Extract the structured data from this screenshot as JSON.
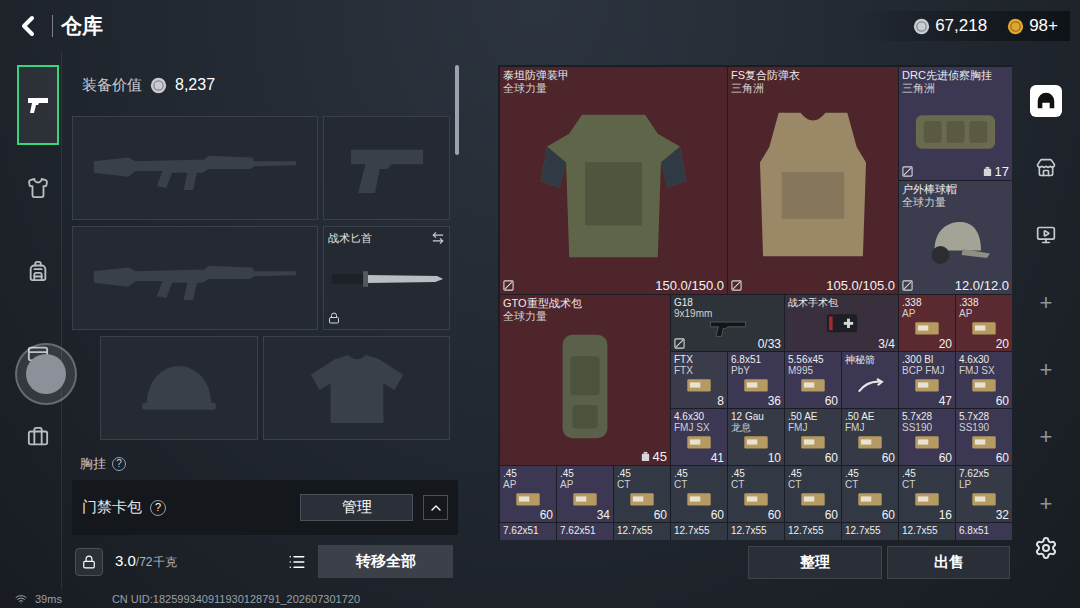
{
  "header": {
    "title": "仓库"
  },
  "currencies": [
    {
      "amount": "67,218",
      "color": "#c9ccd2"
    },
    {
      "amount": "98+",
      "color": "#e3a62b"
    }
  ],
  "side_tabs": [
    {
      "kind": "weapon",
      "selected": true
    },
    {
      "kind": "armor",
      "selected": false
    },
    {
      "kind": "backpack",
      "selected": false
    },
    {
      "kind": "card",
      "selected": false
    },
    {
      "kind": "case",
      "selected": false
    }
  ],
  "loadout": {
    "value_label": "装备价值",
    "value": "8,237",
    "slots": [
      {
        "kind": "rifle",
        "locked": false
      },
      {
        "kind": "pistol",
        "locked": false
      },
      {
        "kind": "rifle",
        "locked": false
      },
      {
        "kind": "knife",
        "label": "战术匕首",
        "locked": true
      },
      {
        "kind": "helmet",
        "locked": false
      },
      {
        "kind": "body-armor",
        "locked": false
      }
    ],
    "next_section": {
      "label": "胸挂",
      "help": "?"
    }
  },
  "keycard_bag": {
    "label": "门禁卡包",
    "help": "?",
    "button": "管理"
  },
  "weight": {
    "current": "3.0",
    "capacity": "/72千克"
  },
  "transfer_button": "转移全部",
  "storage": {
    "items": [
      {
        "name": "泰坦防弹装甲",
        "sub": "全球力量",
        "value": "150.0/150.0",
        "kind": "armor",
        "color": "#4e252b",
        "bound": true,
        "value_icon": false
      },
      {
        "name": "FS复合防弹衣",
        "sub": "三角洲",
        "value": "105.0/105.0",
        "kind": "vest",
        "color": "#4e252b",
        "bound": true,
        "value_icon": false
      },
      {
        "name": "DRC先进侦察胸挂",
        "sub": "三角洲",
        "value": "17",
        "kind": "rig",
        "color": "#3c3752",
        "bound": true,
        "value_icon": true
      },
      {
        "name": "户外棒球帽",
        "sub": "全球力量",
        "value": "12.0/12.0",
        "kind": "hat",
        "color": "#3b3d4f",
        "bound": true,
        "value_icon": false
      },
      {
        "name": "GTO重型战术包",
        "sub": "全球力量",
        "value": "45",
        "kind": "backpack",
        "color": "#4e252b",
        "bound": false,
        "value_icon": true
      },
      {
        "name": "G18",
        "sub": "9x19mm",
        "value": "0/33",
        "kind": "pistol",
        "color": "#2e3239",
        "bound": true,
        "value_icon": false
      },
      {
        "name": "战术手术包",
        "value": "3/4",
        "kind": "medkit",
        "color": "#3a2f3c",
        "bound": false,
        "value_icon": false
      },
      {
        "name": ".338",
        "sub": "AP",
        "value": "20",
        "kind": "ammo",
        "color": "#5b2930",
        "bound": false,
        "value_icon": false
      },
      {
        "name": ".338",
        "sub": "AP",
        "value": "20",
        "kind": "ammo",
        "color": "#5b2930",
        "bound": false,
        "value_icon": false
      },
      {
        "name": "FTX",
        "sub": "FTX",
        "value": "8",
        "kind": "ammo",
        "color": "#3a3b4b",
        "bound": false,
        "value_icon": false
      },
      {
        "name": "6.8x51",
        "sub": "PbY",
        "value": "36",
        "kind": "ammo",
        "color": "#3c3752",
        "bound": false,
        "value_icon": false
      },
      {
        "name": "5.56x45",
        "sub": "M995",
        "value": "60",
        "kind": "ammo",
        "color": "#3c3752",
        "bound": false,
        "value_icon": false
      },
      {
        "name": "神秘箭",
        "value": "",
        "kind": "arrow",
        "color": "#3c3752",
        "bound": false,
        "value_icon": false
      },
      {
        "name": ".300 Bl",
        "sub": "BCP FMJ",
        "value": "47",
        "kind": "ammo",
        "color": "#3c3752",
        "bound": false,
        "value_icon": false
      },
      {
        "name": "4.6x30",
        "sub": "FMJ SX",
        "value": "60",
        "kind": "ammo",
        "color": "#3c3752",
        "bound": false,
        "value_icon": false
      },
      {
        "name": "4.6x30",
        "sub": "FMJ SX",
        "value": "41",
        "kind": "ammo",
        "color": "#3c3752",
        "bound": false,
        "value_icon": false
      },
      {
        "name": "12 Gau",
        "sub": "龙息",
        "value": "10",
        "kind": "ammo",
        "color": "#353a46",
        "bound": false,
        "value_icon": false
      },
      {
        "name": ".50 AE",
        "sub": "FMJ",
        "value": "60",
        "kind": "ammo",
        "color": "#353a46",
        "bound": false,
        "value_icon": false
      },
      {
        "name": ".50 AE",
        "sub": "FMJ",
        "value": "60",
        "kind": "ammo",
        "color": "#353a46",
        "bound": false,
        "value_icon": false
      },
      {
        "name": "5.7x28",
        "sub": "SS190",
        "value": "60",
        "kind": "ammo",
        "color": "#3c3752",
        "bound": false,
        "value_icon": false
      },
      {
        "name": "5.7x28",
        "sub": "SS190",
        "value": "60",
        "kind": "ammo",
        "color": "#3c3752",
        "bound": false,
        "value_icon": false
      },
      {
        "name": ".45",
        "sub": "AP",
        "value": "60",
        "kind": "ammo",
        "color": "#3c3752",
        "bound": false,
        "value_icon": false
      },
      {
        "name": ".45",
        "sub": "AP",
        "value": "34",
        "kind": "ammo",
        "color": "#3c3752",
        "bound": false,
        "value_icon": false
      },
      {
        "name": ".45",
        "sub": "CT",
        "value": "60",
        "kind": "ammo",
        "color": "#323844",
        "bound": false,
        "value_icon": false
      },
      {
        "name": ".45",
        "sub": "CT",
        "value": "60",
        "kind": "ammo",
        "color": "#323844",
        "bound": false,
        "value_icon": false
      },
      {
        "name": ".45",
        "sub": "CT",
        "value": "60",
        "kind": "ammo",
        "color": "#323844",
        "bound": false,
        "value_icon": false
      },
      {
        "name": ".45",
        "sub": "CT",
        "value": "60",
        "kind": "ammo",
        "color": "#323844",
        "bound": false,
        "value_icon": false
      },
      {
        "name": ".45",
        "sub": "CT",
        "value": "60",
        "kind": "ammo",
        "color": "#323844",
        "bound": false,
        "value_icon": false
      },
      {
        "name": ".45",
        "sub": "CT",
        "value": "16",
        "kind": "ammo",
        "color": "#323844",
        "bound": false,
        "value_icon": false
      },
      {
        "name": "7.62x5",
        "sub": "LP",
        "value": "32",
        "kind": "ammo",
        "color": "#353a46",
        "bound": false,
        "value_icon": false
      },
      {
        "name": "7.62x51",
        "kind": "ammo",
        "color": "#3c3752",
        "bound": false,
        "value_icon": false
      },
      {
        "name": "7.62x51",
        "kind": "ammo",
        "color": "#3c3752",
        "bound": false,
        "value_icon": false
      },
      {
        "name": "12.7x55",
        "kind": "ammo",
        "color": "#323844",
        "bound": false,
        "value_icon": false
      },
      {
        "name": "12.7x55",
        "kind": "ammo",
        "color": "#323844",
        "bound": false,
        "value_icon": false
      },
      {
        "name": "12.7x55",
        "kind": "ammo",
        "color": "#323844",
        "bound": false,
        "value_icon": false
      },
      {
        "name": "12.7x55",
        "kind": "ammo",
        "color": "#323844",
        "bound": false,
        "value_icon": false
      },
      {
        "name": "12.7x55",
        "kind": "ammo",
        "color": "#323844",
        "bound": false,
        "value_icon": false
      },
      {
        "name": "12.7x55",
        "kind": "ammo",
        "color": "#323844",
        "bound": false,
        "value_icon": false
      },
      {
        "name": "6.8x51",
        "kind": "ammo",
        "color": "#3c3752",
        "bound": false,
        "value_icon": false
      }
    ]
  },
  "storage_buttons": [
    "整理",
    "出售"
  ],
  "right_tabs": [
    {
      "kind": "stash",
      "selected": true
    },
    {
      "kind": "shop",
      "selected": false
    },
    {
      "kind": "monitor",
      "selected": false
    }
  ],
  "add_slots": [
    "+",
    "+",
    "+",
    "+"
  ],
  "status_bar": {
    "ping": "39ms",
    "uid": "CN UID:182599340911930128791_202607301720"
  }
}
